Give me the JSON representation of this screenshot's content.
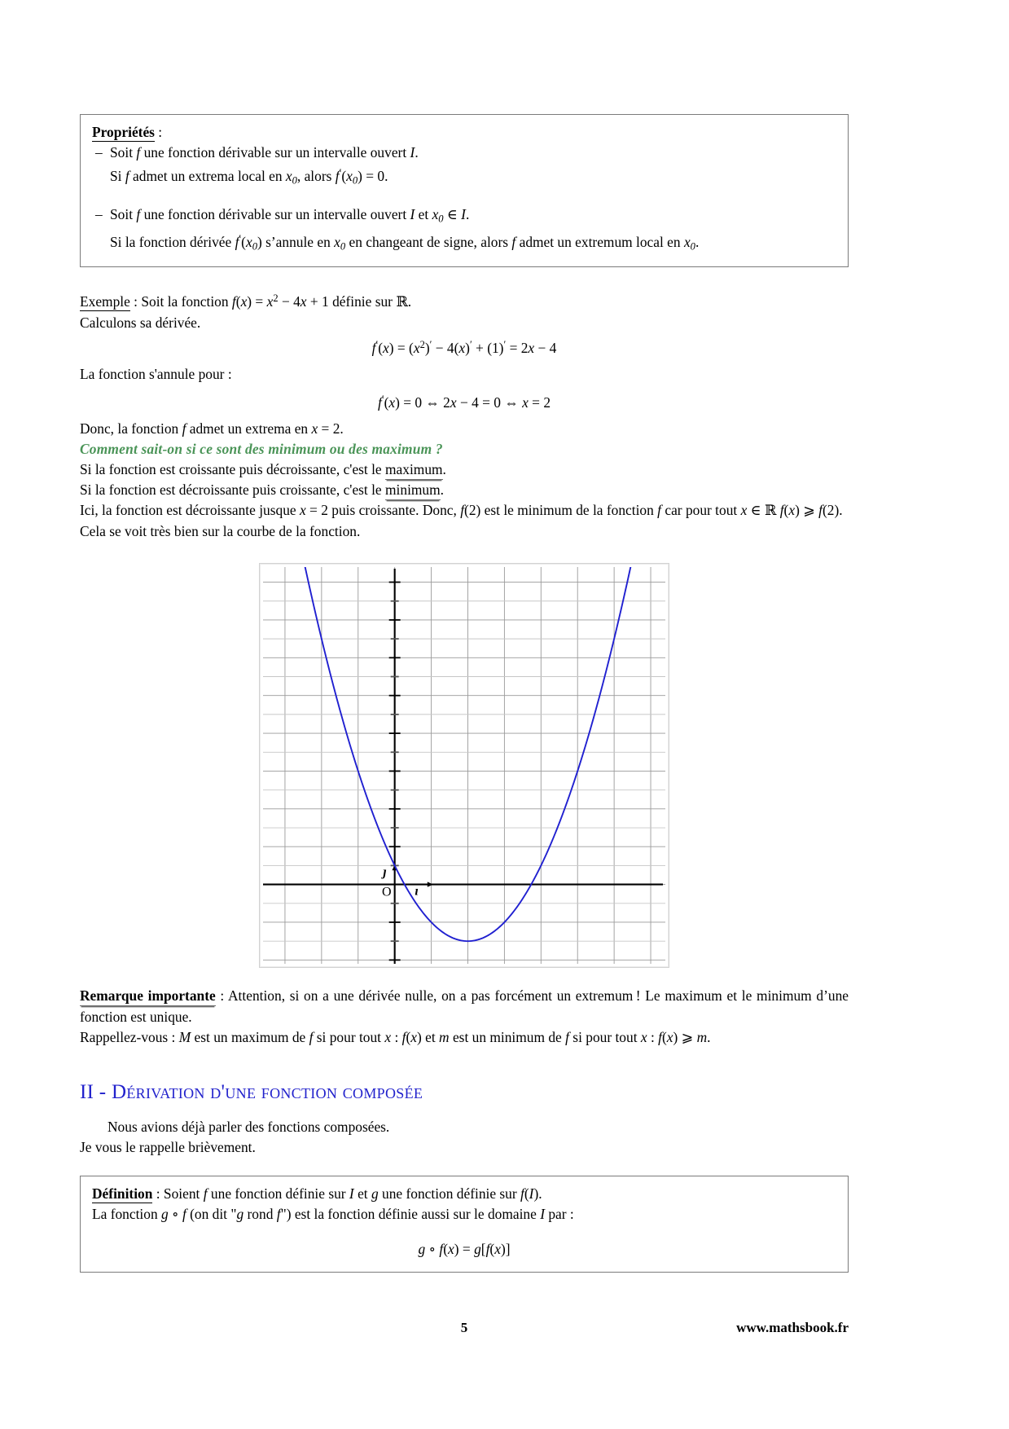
{
  "document": {
    "page_number": "5",
    "website": "www.mathsbook.fr",
    "accent_color": "#2222cc",
    "green_color": "#4a9457",
    "curve_color": "#2020d0"
  },
  "properties_box": {
    "title": "Propriétés",
    "title_colon": " :",
    "item1_line1": "Soit f une fonction dérivable sur un intervalle ouvert I.",
    "item1_line2": "Si f admet un extrema local en x0, alors f'(x0) = 0.",
    "item2_line1": "Soit f une fonction dérivable sur un intervalle ouvert I et x0 ∈ I.",
    "item2_line2": "Si la fonction dérivée f'(x0) s'annule en x0 en changeant de signe, alors f admet un extremum local en x0."
  },
  "example": {
    "label": "Exemple",
    "line1_rest": " : Soit la fonction f(x) = x² − 4x + 1 définie sur ℝ.",
    "line2": "Calculons sa dérivée.",
    "equation1": "f'(x) = (x²)' − 4(x)' + (1)' = 2x − 4",
    "line3": "La fonction s'annule pour :",
    "equation2": "f'(x) = 0 ⇔ 2x − 4 = 0 ⇔ x = 2",
    "line4": "Donc, la fonction f admet un extrema en x = 2.",
    "question": "Comment sait-on si ce sont des minimum ou des maximum ?",
    "line5_a": "Si la fonction est croissante puis décroissante, c'est le ",
    "line5_underlined": "maximum",
    "line5_b": ".",
    "line6_a": "Si la fonction est décroissante puis croissante, c'est le ",
    "line6_underlined": "minimum",
    "line6_b": ".",
    "line7": "Ici, la fonction est décroissante jusque x = 2 puis croissante. Donc, f(2) est le minimum de la fonction f car pour tout x ∈ ℝ f(x) ⩾ f(2).",
    "line8": "Cela se voit très bien sur la courbe de la fonction."
  },
  "figure": {
    "origin_label": "O",
    "vector_i": "ı⃗",
    "vector_j": "ȷ⃗"
  },
  "chart_data": {
    "type": "line",
    "title": "",
    "xlabel": "",
    "ylabel": "",
    "function": "f(x) = x^2 - 4x + 1",
    "xlim": [
      -3.6,
      7.4
    ],
    "ylim": [
      -4.2,
      16.8
    ],
    "x_major_step": 1,
    "y_major_step": 1,
    "grid": true,
    "axes": {
      "x_axis_at_y": 0,
      "y_axis_at_x": 0,
      "arrowheads": true
    },
    "annotations": [
      {
        "text": "O",
        "x": -0.35,
        "y": -0.6
      },
      {
        "text": "ȷ⃗",
        "x": -0.32,
        "y": 0.45
      },
      {
        "text": "ı⃗",
        "x": 0.55,
        "y": -0.55
      }
    ],
    "series": [
      {
        "name": "f",
        "color": "#2020d0",
        "x": [
          -2.6,
          -2.2,
          -1.8,
          -1.4,
          -1.0,
          -0.6,
          -0.2,
          0.2,
          0.6,
          1.0,
          1.4,
          1.8,
          2.0,
          2.2,
          2.6,
          3.0,
          3.4,
          3.8,
          4.2,
          4.6,
          5.0,
          5.4,
          5.8,
          6.2,
          6.6
        ],
        "y": [
          18.16,
          14.64,
          11.44,
          8.56,
          6.0,
          3.76,
          1.84,
          0.24,
          -1.04,
          -2.0,
          -2.64,
          -2.96,
          -3.0,
          -2.96,
          -2.64,
          -2.0,
          -1.04,
          0.24,
          1.84,
          3.76,
          6.0,
          8.56,
          11.44,
          14.64,
          18.16
        ]
      }
    ],
    "minimum_point": {
      "x": 2,
      "y": -3
    }
  },
  "remark": {
    "label": "Remarque importante",
    "text_a": " : Attention, si on a une dérivée nulle, on a pas forcément un extremum ! Le maximum et le minimum d'une fonction est unique.",
    "text_b": "Rappellez-vous : M est un maximum de f si pour tout x : f(x) et m est un minimum de f si pour tout x : f(x) ⩾ m."
  },
  "section2": {
    "number": "II - ",
    "title": "Dérivation d'une fonction composée",
    "intro_line1": "Nous avions déjà parler des fonctions composées.",
    "intro_line2": "Je vous le rappelle brièvement."
  },
  "definition_box": {
    "label": "Définition",
    "line1_rest": " : Soient f une fonction définie sur I et g une fonction définie sur f(I).",
    "line2": "La fonction g ∘ f (on dit \"g rond f\") est la fonction définie aussi sur le domaine I par :",
    "equation": "g ∘ f(x) = g[f(x)]"
  }
}
